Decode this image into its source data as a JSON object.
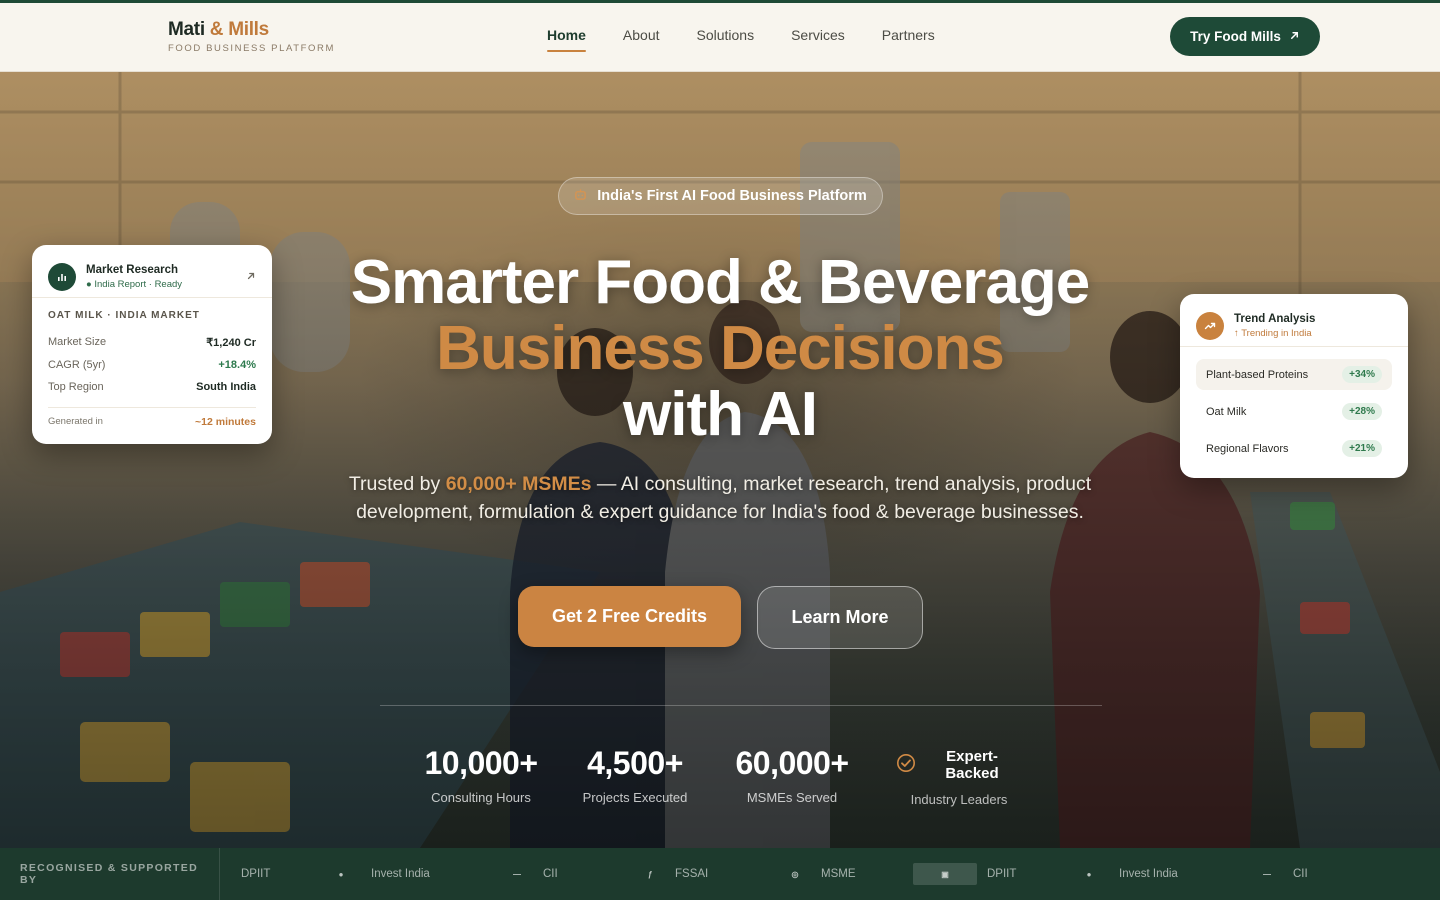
{
  "brand": {
    "name_part1": "Mati",
    "name_part2": "& Mills",
    "tagline": "FOOD BUSINESS PLATFORM"
  },
  "nav": {
    "links": [
      {
        "label": "Home",
        "active": true
      },
      {
        "label": "About",
        "active": false
      },
      {
        "label": "Solutions",
        "active": false
      },
      {
        "label": "Services",
        "active": false
      },
      {
        "label": "Partners",
        "active": false
      }
    ],
    "cta_label": "Try Food Mills",
    "cta_icon": "arrow-up-right-icon"
  },
  "hero": {
    "pill_label": "India's First AI Food Business Platform",
    "pill_icon": "robot-icon",
    "headline_line1": "Smarter Food & Beverage",
    "headline_line2": "Business Decisions",
    "headline_line3": "with AI",
    "sub_prefix": "Trusted by ",
    "sub_highlight": "60,000+ MSMEs",
    "sub_text": " — AI consulting, market research, trend analysis, product development, formulation & expert guidance for India's food & beverage businesses.",
    "primary_button": "Get 2 Free Credits",
    "secondary_button": "Learn More",
    "stats": [
      {
        "value": "10,000+",
        "label": "Consulting Hours"
      },
      {
        "value": "4,500+",
        "label": "Projects Executed"
      },
      {
        "value": "60,000+",
        "label": "MSMEs Served"
      }
    ],
    "badge": {
      "title": "Expert-Backed",
      "label": "Industry Leaders",
      "icon": "check-circle-icon"
    }
  },
  "market_card": {
    "title": "Market Research",
    "subtitle": "● India Report · Ready",
    "icon": "bar-chart-icon",
    "section": "OAT MILK · INDIA MARKET",
    "rows": [
      {
        "key": "Market Size",
        "value": "₹1,240 Cr"
      },
      {
        "key": "CAGR (5yr)",
        "value": "+18.4%"
      },
      {
        "key": "Top Region",
        "value": "South India"
      }
    ],
    "footer_key": "Generated in",
    "footer_value": "~12 minutes"
  },
  "trend_card": {
    "title": "Trend Analysis",
    "subtitle": "↑ Trending in India",
    "icon": "trending-up-icon",
    "items": [
      {
        "name": "Plant-based Proteins",
        "value": "+34%"
      },
      {
        "name": "Oat Milk",
        "value": "+28%"
      },
      {
        "name": "Regional Flavors",
        "value": "+21%"
      }
    ]
  },
  "partners": {
    "label": "RECOGNISED & SUPPORTED BY",
    "items": [
      "DPIIT",
      "Invest India",
      "CII",
      "FSSAI",
      "MSME",
      "DPIIT",
      "Invest India",
      "CII"
    ]
  },
  "colors": {
    "brand_green": "#1e4a37",
    "accent_orange": "#cb8442",
    "nav_bg": "#f8f5ee"
  }
}
